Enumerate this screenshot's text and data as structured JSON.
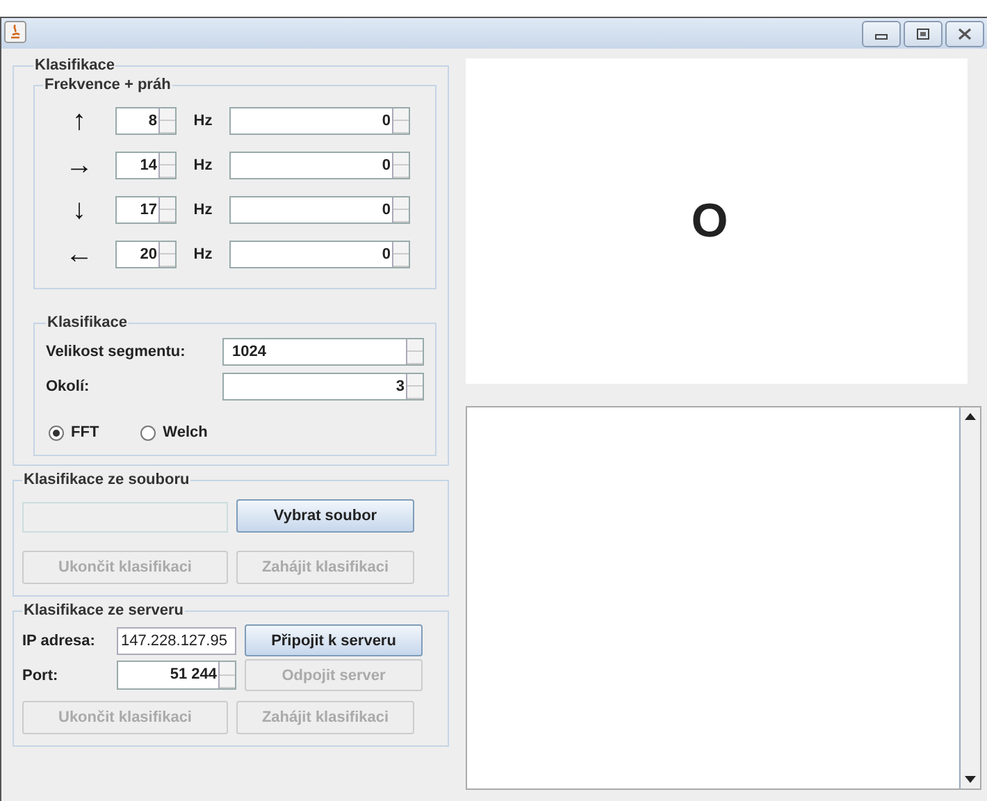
{
  "classification": {
    "title": "Klasifikace",
    "frequency_group": {
      "title": "Frekvence + práh",
      "rows": [
        {
          "arrow": "↑",
          "frequency": "8",
          "unit": "Hz",
          "threshold": "0"
        },
        {
          "arrow": "→",
          "frequency": "14",
          "unit": "Hz",
          "threshold": "0"
        },
        {
          "arrow": "↓",
          "frequency": "17",
          "unit": "Hz",
          "threshold": "0"
        },
        {
          "arrow": "←",
          "frequency": "20",
          "unit": "Hz",
          "threshold": "0"
        }
      ]
    },
    "settings": {
      "title": "Klasifikace",
      "fields": [
        {
          "label": "Velikost segmentu:",
          "value": "1024"
        },
        {
          "label": "Okolí:",
          "value": "3"
        }
      ],
      "methods": [
        {
          "label": "FFT",
          "selected": true
        },
        {
          "label": "Welch",
          "selected": false
        }
      ]
    }
  },
  "file_group": {
    "title": "Klasifikace ze souboru",
    "path": {
      "disabled": true
    },
    "buttons": [
      {
        "label": "Vybrat soubor",
        "disabled": false
      },
      {
        "label": "Ukončit klasifikaci",
        "disabled": true
      },
      {
        "label": "Zahájit klasifikaci",
        "disabled": true
      }
    ]
  },
  "server_group": {
    "title": "Klasifikace ze serveru",
    "ip_label": "IP adresa:",
    "ip": "147.228.127.95",
    "port_label": "Port:",
    "port": "51 244",
    "buttons": [
      {
        "label": "Připojit k serveru",
        "disabled": false
      },
      {
        "label": "Odpojit server",
        "disabled": true
      },
      {
        "label": "Ukončit klasifikaci",
        "disabled": true
      },
      {
        "label": "Zahájit klasifikaci",
        "disabled": true
      }
    ]
  },
  "display": {
    "symbol": "O"
  }
}
